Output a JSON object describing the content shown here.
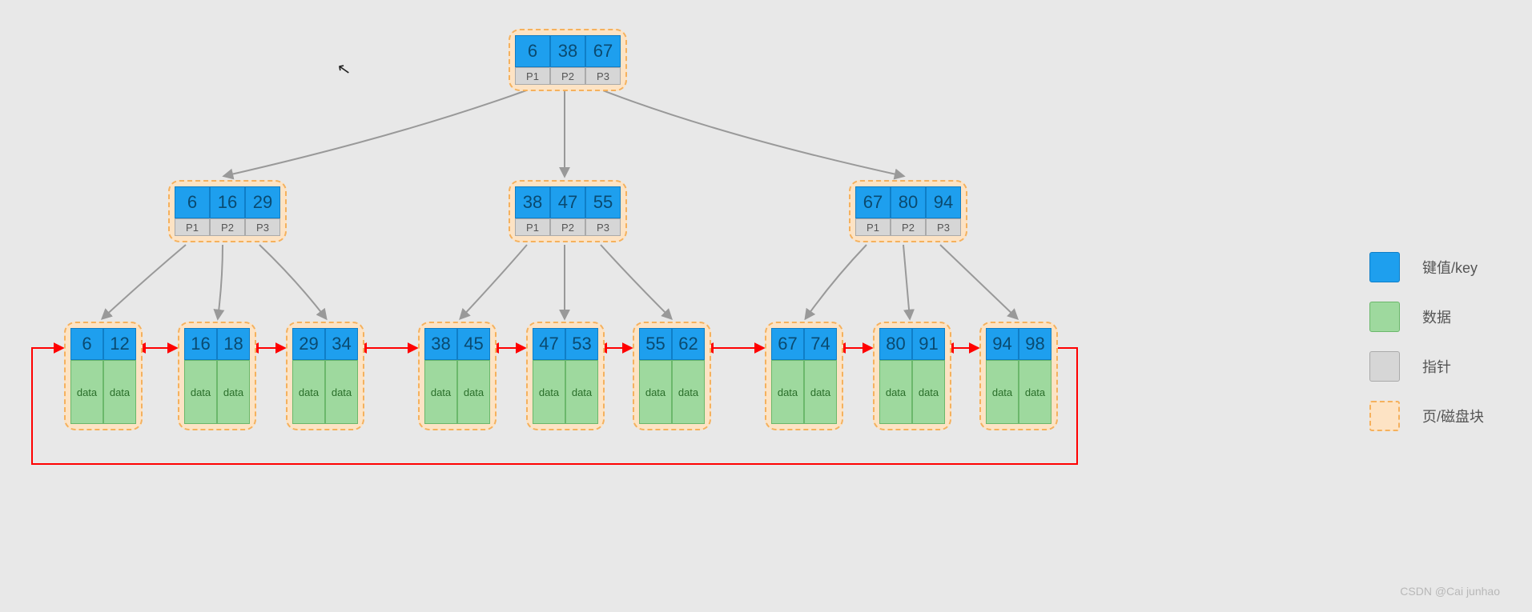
{
  "root": {
    "keys": [
      "6",
      "38",
      "67"
    ],
    "ptrs": [
      "P1",
      "P2",
      "P3"
    ]
  },
  "mid": [
    {
      "keys": [
        "6",
        "16",
        "29"
      ],
      "ptrs": [
        "P1",
        "P2",
        "P3"
      ]
    },
    {
      "keys": [
        "38",
        "47",
        "55"
      ],
      "ptrs": [
        "P1",
        "P2",
        "P3"
      ]
    },
    {
      "keys": [
        "67",
        "80",
        "94"
      ],
      "ptrs": [
        "P1",
        "P2",
        "P3"
      ]
    }
  ],
  "leaves": [
    {
      "keys": [
        "6",
        "12"
      ],
      "data": [
        "data",
        "data"
      ]
    },
    {
      "keys": [
        "16",
        "18"
      ],
      "data": [
        "data",
        "data"
      ]
    },
    {
      "keys": [
        "29",
        "34"
      ],
      "data": [
        "data",
        "data"
      ]
    },
    {
      "keys": [
        "38",
        "45"
      ],
      "data": [
        "data",
        "data"
      ]
    },
    {
      "keys": [
        "47",
        "53"
      ],
      "data": [
        "data",
        "data"
      ]
    },
    {
      "keys": [
        "55",
        "62"
      ],
      "data": [
        "data",
        "data"
      ]
    },
    {
      "keys": [
        "67",
        "74"
      ],
      "data": [
        "data",
        "data"
      ]
    },
    {
      "keys": [
        "80",
        "91"
      ],
      "data": [
        "data",
        "data"
      ]
    },
    {
      "keys": [
        "94",
        "98"
      ],
      "data": [
        "data",
        "data"
      ]
    }
  ],
  "legend": {
    "key": "键值/key",
    "data": "数据",
    "ptr": "指针",
    "page": "页/磁盘块"
  },
  "watermark": "CSDN @Cai junhao"
}
